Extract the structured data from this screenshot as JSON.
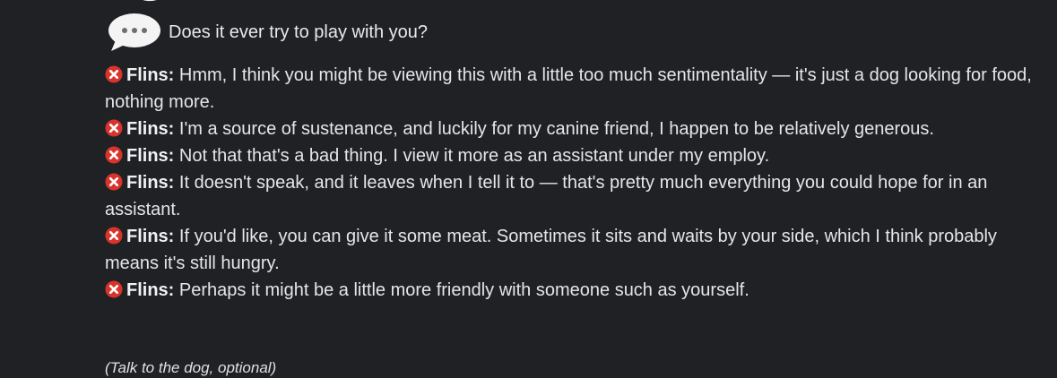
{
  "choice": {
    "icon": "speech-bubble-icon",
    "text": "Does it ever try to play with you?"
  },
  "dialogue": [
    {
      "icon": "close-icon",
      "speaker": "Flins:",
      "text": "Hmm, I think you might be viewing this with a little too much sentimentality — it's just a dog looking for food, nothing more."
    },
    {
      "icon": "close-icon",
      "speaker": "Flins:",
      "text": "I'm a source of sustenance, and luckily for my canine friend, I happen to be relatively generous."
    },
    {
      "icon": "close-icon",
      "speaker": "Flins:",
      "text": "Not that that's a bad thing. I view it more as an assistant under my employ."
    },
    {
      "icon": "close-icon",
      "speaker": "Flins:",
      "text": "It doesn't speak, and it leaves when I tell it to — that's pretty much everything you could hope for in an assistant."
    },
    {
      "icon": "close-icon",
      "speaker": "Flins:",
      "text": "If you'd like, you can give it some meat. Sometimes it sits and waits by your side, which I think probably means it's still hungry."
    },
    {
      "icon": "close-icon",
      "speaker": "Flins:",
      "text": "Perhaps it might be a little more friendly with someone such as yourself."
    }
  ],
  "footer_note": "(Talk to the dog, optional)",
  "colors": {
    "background": "#202125",
    "text": "#e6e6e6",
    "icon_red": "#d9342b",
    "bubble": "#f4f4f4"
  }
}
